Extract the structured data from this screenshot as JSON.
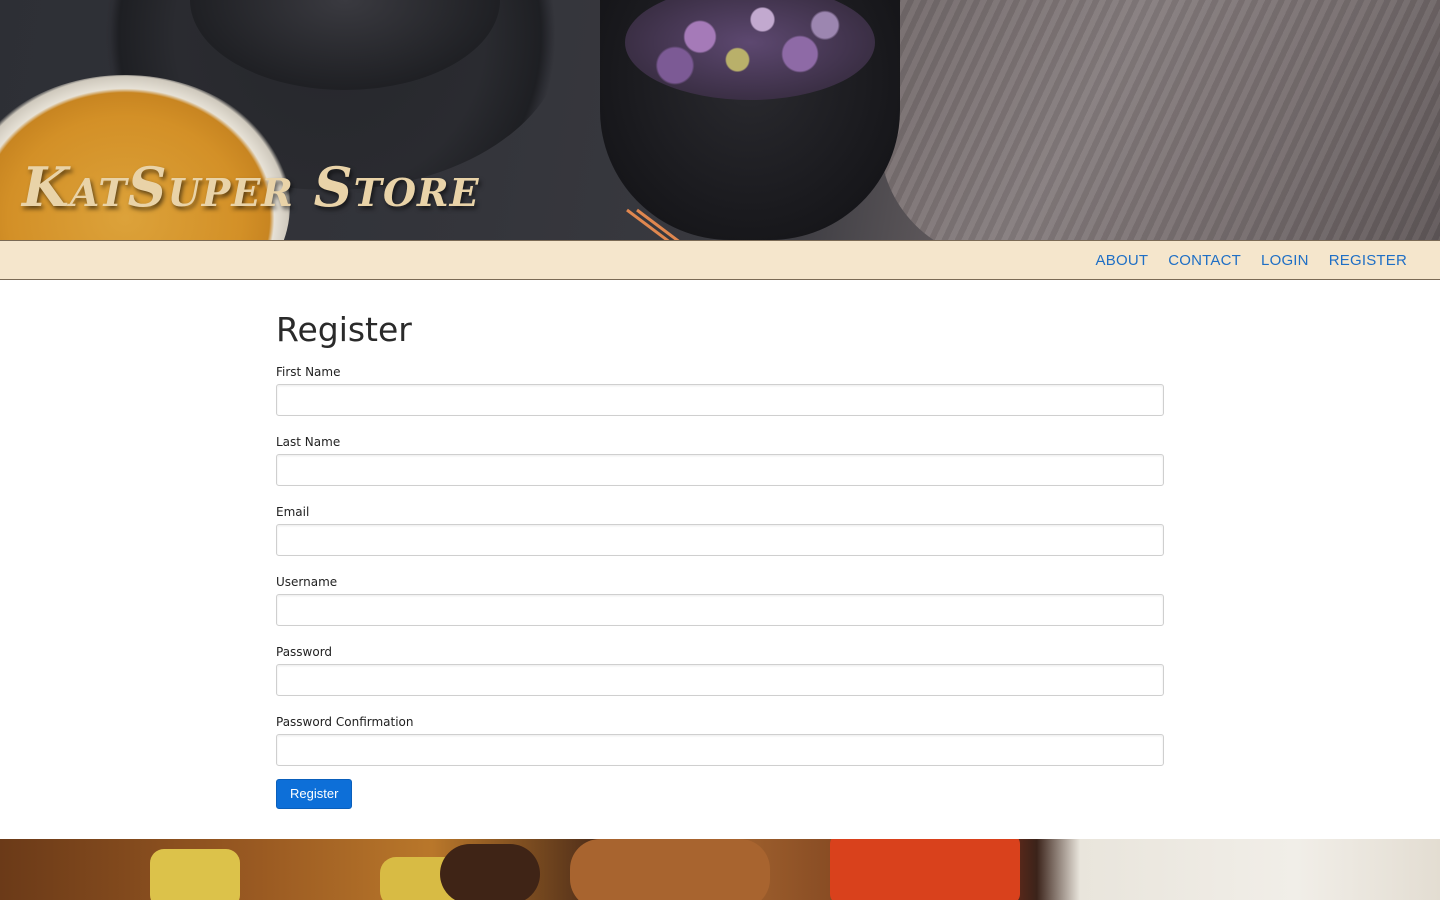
{
  "brand": {
    "title": "KatSuper Store"
  },
  "nav": {
    "items": [
      {
        "label": "ABOUT"
      },
      {
        "label": "CONTACT"
      },
      {
        "label": "LOGIN"
      },
      {
        "label": "REGISTER"
      }
    ]
  },
  "form": {
    "title": "Register",
    "fields": [
      {
        "label": "First Name",
        "value": ""
      },
      {
        "label": "Last Name",
        "value": ""
      },
      {
        "label": "Email",
        "value": ""
      },
      {
        "label": "Username",
        "value": ""
      },
      {
        "label": "Password",
        "value": ""
      },
      {
        "label": "Password Confirmation",
        "value": ""
      }
    ],
    "submit_label": "Register"
  },
  "colors": {
    "navbar_bg": "#f5e6cc",
    "link": "#1f6fc5",
    "button_bg": "#0d6fd8",
    "brand_text": "#e9d3a8"
  }
}
